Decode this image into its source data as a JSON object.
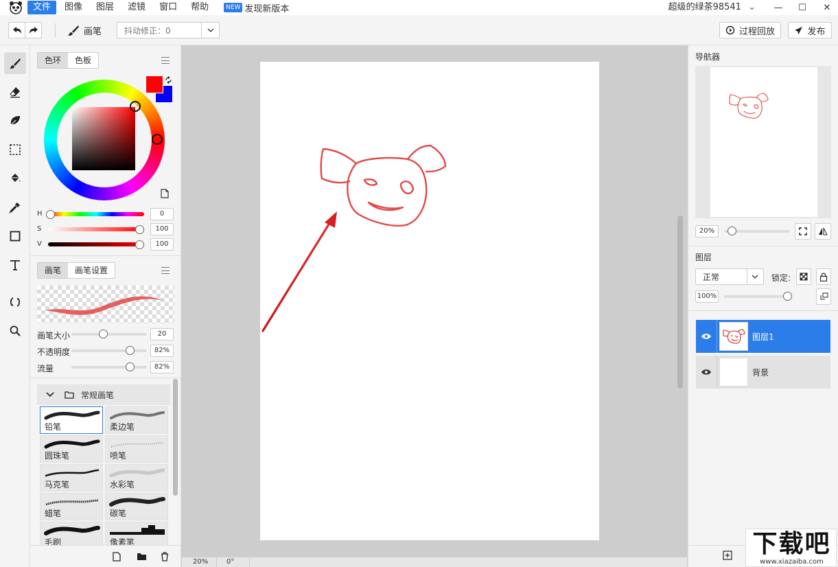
{
  "menubar": {
    "items": [
      "文件",
      "图像",
      "图层",
      "滤镜",
      "窗口",
      "帮助"
    ],
    "new_badge": "NEW",
    "new_text": "发现新版本",
    "user": "超级的绿茶98541",
    "user_chevron": "⌄"
  },
  "window": {
    "minimize": "—",
    "maximize": "☐",
    "close": "✕"
  },
  "toolbar": {
    "brush_label": "画笔",
    "jitter_label": "抖动修正：0",
    "replay_label": "过程回放",
    "publish_label": "发布"
  },
  "color_panel": {
    "tabs": [
      "色环",
      "色板"
    ],
    "primary_color": "#ff0000",
    "secondary_color": "#0000ff",
    "h_label": "H",
    "h_value": "0",
    "s_label": "S",
    "s_value": "100",
    "v_label": "V",
    "v_value": "100"
  },
  "brush_panel": {
    "tabs": [
      "画笔",
      "画笔设置"
    ],
    "size_label": "画笔大小",
    "size_value": "20",
    "opacity_label": "不透明度",
    "opacity_value": "82%",
    "flow_label": "流量",
    "flow_value": "82%",
    "group_label": "常规画笔",
    "brushes": [
      "铅笔",
      "柔边笔",
      "圆珠笔",
      "喷笔",
      "马克笔",
      "水彩笔",
      "蜡笔",
      "碳笔",
      "毛刷",
      "像素笔"
    ]
  },
  "status": {
    "zoom": "20%",
    "rotation": "0°"
  },
  "navigator": {
    "title": "导航器",
    "zoom": "20%"
  },
  "layers": {
    "title": "图层",
    "blend_mode": "正常",
    "lock_label": "锁定:",
    "opacity": "100%",
    "items": [
      {
        "name": "图层1",
        "selected": true
      },
      {
        "name": "背景",
        "selected": false
      }
    ]
  },
  "accent_color": "#2b7de9",
  "stroke_color": "#e24848",
  "watermark": {
    "main": "下载吧",
    "url": "www.xiazaiba.com"
  }
}
